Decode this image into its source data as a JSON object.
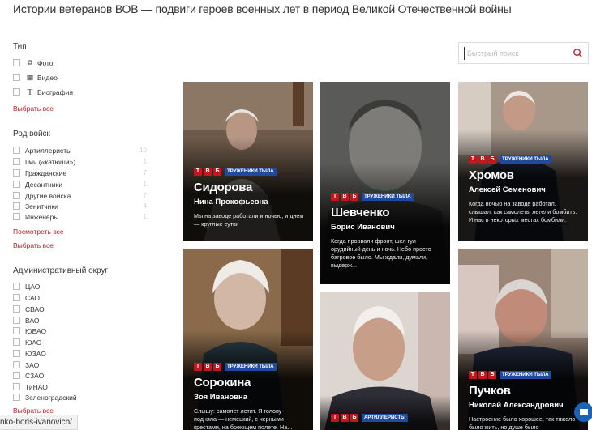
{
  "page": {
    "title": "Истории ветеранов ВОВ — подвиги героев военных лет в период Великой Отечественной войны"
  },
  "search": {
    "placeholder": "Быстрый поиск"
  },
  "filters": {
    "type": {
      "heading": "Тип",
      "items": [
        {
          "label": "Фото",
          "icon": "photo-icon"
        },
        {
          "label": "Видео",
          "icon": "video-icon"
        },
        {
          "label": "Биография",
          "icon": "text-icon"
        }
      ],
      "select_all": "Выбрать все"
    },
    "troops": {
      "heading": "Род войск",
      "items": [
        {
          "label": "Артиллеристы",
          "count": "10"
        },
        {
          "label": "Гмч («катюши»)",
          "count": "1"
        },
        {
          "label": "Гражданские",
          "count": "7"
        },
        {
          "label": "Десантники",
          "count": "1"
        },
        {
          "label": "Другие войска",
          "count": "7"
        },
        {
          "label": "Зенитчики",
          "count": "4"
        },
        {
          "label": "Инженеры",
          "count": "1"
        }
      ],
      "see_all": "Посмотреть все",
      "select_all": "Выбрать все"
    },
    "district": {
      "heading": "Административный округ",
      "items": [
        "ЦАО",
        "САО",
        "СВАО",
        "ВАО",
        "ЮВАО",
        "ЮАО",
        "ЮЗАО",
        "ЗАО",
        "СЗАО",
        "ТиНАО",
        "Зеленоградский"
      ],
      "select_all": "Выбрать все"
    }
  },
  "badges": {
    "t": "Т",
    "v": "В",
    "b": "Б"
  },
  "cards": [
    {
      "surname": "Сидорова",
      "name": "Нина Прокофьевна",
      "quote": "Мы на заводе работали и ночью, и днем — круглые сутки",
      "tag": "ТРУЖЕНИКИ ТЫЛА"
    },
    {
      "surname": "Шевченко",
      "name": "Борис Иванович",
      "quote": "Когда прорвали фронт, шел гул орудийный день и ночь. Небо просто багровое было. Мы ждали, думали, выдерж...",
      "tag": "ТРУЖЕНИКИ ТЫЛА"
    },
    {
      "surname": "Хромов",
      "name": "Алексей Семенович",
      "quote": "Когда ночью на заводе работал, слышал, как самолеты летели бомбить. И нас в некоторых местах бомбили.",
      "tag": "ТРУЖЕНИКИ ТЫЛА"
    },
    {
      "surname": "Сорокина",
      "name": "Зоя Ивановна",
      "quote": "Слышу: самолет летит. Я голову подняла — немецкий, с черными крестами, на бреющем полете. На...",
      "tag": "ТРУЖЕНИКИ ТЫЛА"
    },
    {
      "surname": "",
      "name": "",
      "quote": "",
      "tag": "АРТИЛЛЕРИСТЫ"
    },
    {
      "surname": "Пучков",
      "name": "Николай Александрович",
      "quote": "Настроение было хорошее, так тяжело было жить, но душе было",
      "tag": "ТРУЖЕНИКИ ТЫЛА"
    }
  ],
  "status_url": "nko-boris-ivanovich/"
}
